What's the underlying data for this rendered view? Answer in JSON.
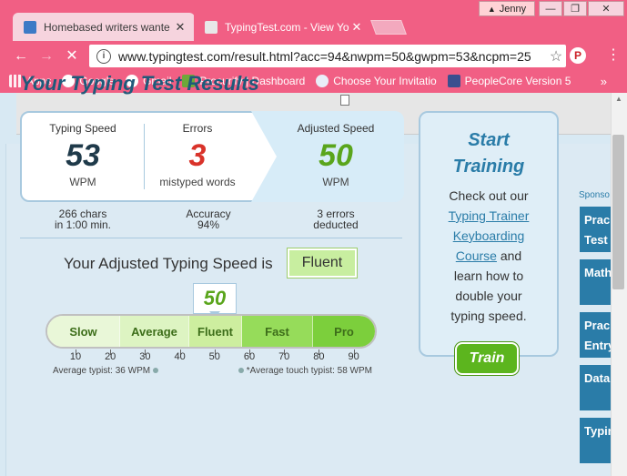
{
  "browser": {
    "tabs": [
      {
        "title": "Homebased writers wante"
      },
      {
        "title": "TypingTest.com - View Yo"
      }
    ],
    "profile_name": "Jenny",
    "url": "www.typingtest.com/result.html?acc=94&nwpm=50&gwpm=53&ncpm=25",
    "bookmarks": [
      {
        "label": "Apps"
      },
      {
        "label": "Google"
      },
      {
        "label": "Gmail"
      },
      {
        "label": "Procurify | Dashboard"
      },
      {
        "label": "Choose Your Invitatio"
      },
      {
        "label": "PeopleCore Version 5"
      }
    ],
    "more_bookmarks": "»",
    "window_controls": {
      "minimize": "—",
      "maximize": "❐",
      "close": "✕"
    }
  },
  "results": {
    "title": "Your Typing Test Results",
    "typing_speed": {
      "label": "Typing Speed",
      "value": "53",
      "unit": "WPM"
    },
    "errors": {
      "label": "Errors",
      "value": "3",
      "unit": "mistyped words"
    },
    "adjusted_speed": {
      "label": "Adjusted Speed",
      "value": "50",
      "unit": "WPM"
    },
    "stats": [
      {
        "line1": "266 chars",
        "line2": "in 1:00 min."
      },
      {
        "line1": "Accuracy",
        "line2": "94%"
      },
      {
        "line1": "3 errors",
        "line2": "deducted"
      }
    ],
    "adjusted_text": "Your Adjusted Typing Speed is",
    "level": "Fluent",
    "marker_value": "50",
    "bar_segments": [
      {
        "label": "Slow",
        "color": "#e9f7d8"
      },
      {
        "label": "Average",
        "color": "#ddf4c2"
      },
      {
        "label": "Fluent",
        "color": "#cdee9f"
      },
      {
        "label": "Fast",
        "color": "#96dc5a"
      },
      {
        "label": "Pro",
        "color": "#7ccf3c"
      }
    ],
    "axis_ticks": [
      "10",
      "20",
      "30",
      "40",
      "50",
      "60",
      "70",
      "80",
      "90"
    ],
    "average_note": "Average typist: 36 WPM",
    "touch_note": "*Average touch typist: 58 WPM"
  },
  "training": {
    "title_line1": "Start",
    "title_line2": "Training",
    "intro": "Check out our",
    "link1": "Typing Trainer",
    "link2": "Keyboarding",
    "link3": "Course",
    "outro1": "and",
    "outro2": "learn how to",
    "outro3": "double your",
    "outro4": "typing speed.",
    "button": "Train"
  },
  "sidebar": {
    "sponsor_label": "Sponso",
    "items": [
      {
        "line1": "Prac",
        "line2": "Test"
      },
      {
        "line1": "Math",
        "line2": ""
      },
      {
        "line1": "Prac",
        "line2": "Entry"
      },
      {
        "line1": "Data",
        "line2": ""
      },
      {
        "line1": "Typin",
        "line2": ""
      }
    ]
  },
  "colors": {
    "chrome_pink": "#f15f84",
    "title_blue": "#1f5a7a",
    "speed_dark": "#1f3a4a",
    "errors_red": "#d9332a",
    "adjusted_green": "#5aa51c"
  }
}
